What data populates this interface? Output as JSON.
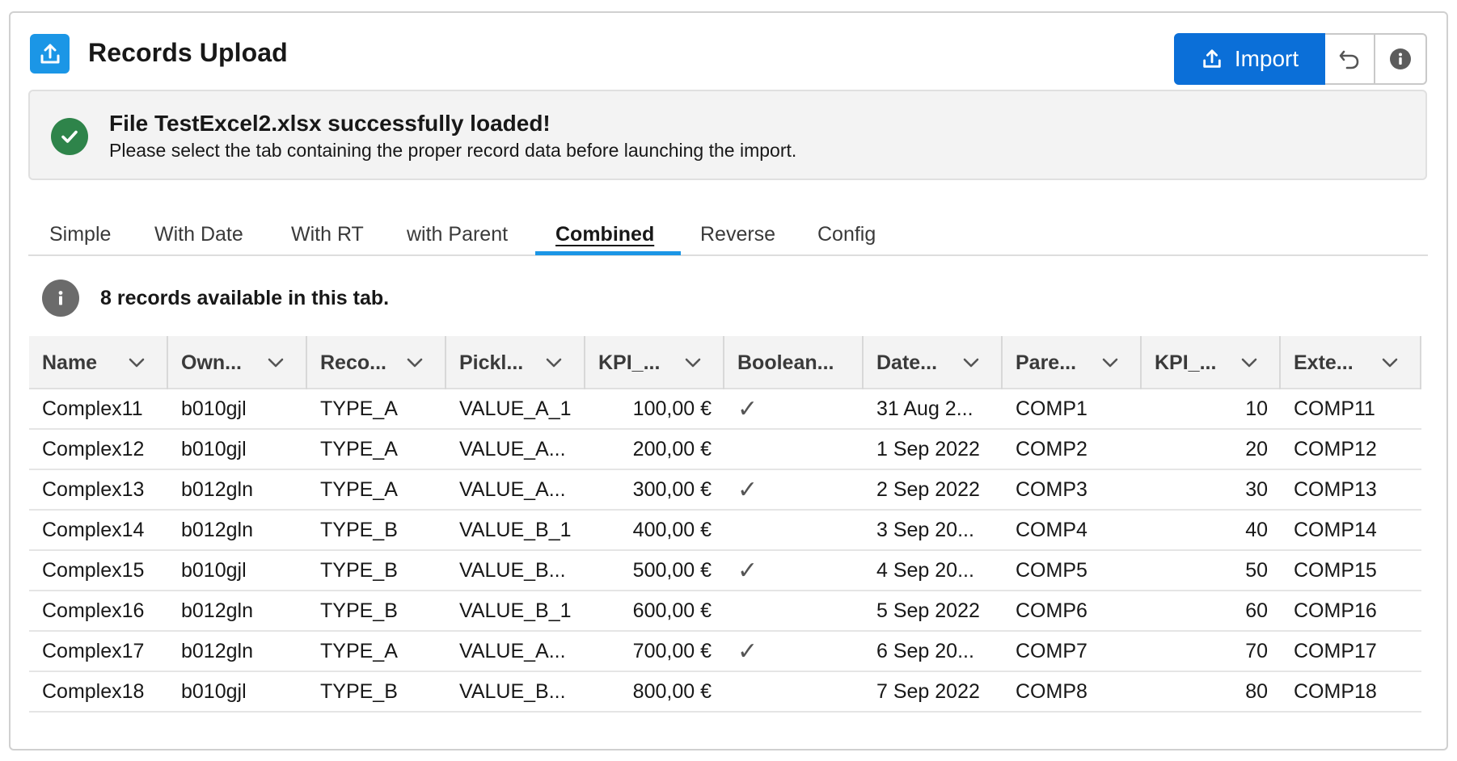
{
  "header": {
    "title": "Records Upload",
    "app_icon": "upload-icon",
    "import_label": "Import",
    "undo_icon": "undo-icon",
    "info_icon": "info-icon"
  },
  "notice": {
    "icon": "check-icon",
    "title": "File TestExcel2.xlsx successfully loaded!",
    "message": "Please select the tab containing the proper record data before launching the import."
  },
  "tabs": {
    "items": [
      {
        "label": "Simple"
      },
      {
        "label": "With Date"
      },
      {
        "label": "With RT"
      },
      {
        "label": "with Parent"
      },
      {
        "label": "Combined"
      },
      {
        "label": "Reverse"
      },
      {
        "label": "Config"
      }
    ],
    "active": "Combined"
  },
  "info": {
    "text": "8 records available in this tab."
  },
  "table": {
    "columns": [
      "Name",
      "Own...",
      "Reco...",
      "Pickl...",
      "KPI_...",
      "Boolean...",
      "Date...",
      "Pare...",
      "KPI_...",
      "Exte..."
    ],
    "rows": [
      [
        "Complex11",
        "b010gjl",
        "TYPE_A",
        "VALUE_A_1",
        "100,00 €",
        "✓",
        "31 Aug 2...",
        "COMP1",
        "10",
        "COMP11"
      ],
      [
        "Complex12",
        "b010gjl",
        "TYPE_A",
        "VALUE_A...",
        "200,00 €",
        "",
        "1 Sep 2022",
        "COMP2",
        "20",
        "COMP12"
      ],
      [
        "Complex13",
        "b012gln",
        "TYPE_A",
        "VALUE_A...",
        "300,00 €",
        "✓",
        "2 Sep 2022",
        "COMP3",
        "30",
        "COMP13"
      ],
      [
        "Complex14",
        "b012gln",
        "TYPE_B",
        "VALUE_B_1",
        "400,00 €",
        "",
        "3 Sep 20...",
        "COMP4",
        "40",
        "COMP14"
      ],
      [
        "Complex15",
        "b010gjl",
        "TYPE_B",
        "VALUE_B...",
        "500,00 €",
        "✓",
        "4 Sep 20...",
        "COMP5",
        "50",
        "COMP15"
      ],
      [
        "Complex16",
        "b012gln",
        "TYPE_B",
        "VALUE_B_1",
        "600,00 €",
        "",
        "5 Sep 2022",
        "COMP6",
        "60",
        "COMP16"
      ],
      [
        "Complex17",
        "b012gln",
        "TYPE_A",
        "VALUE_A...",
        "700,00 €",
        "✓",
        "6 Sep 20...",
        "COMP7",
        "70",
        "COMP17"
      ],
      [
        "Complex18",
        "b010gjl",
        "TYPE_B",
        "VALUE_B...",
        "800,00 €",
        "",
        "7 Sep 2022",
        "COMP8",
        "80",
        "COMP18"
      ]
    ]
  }
}
